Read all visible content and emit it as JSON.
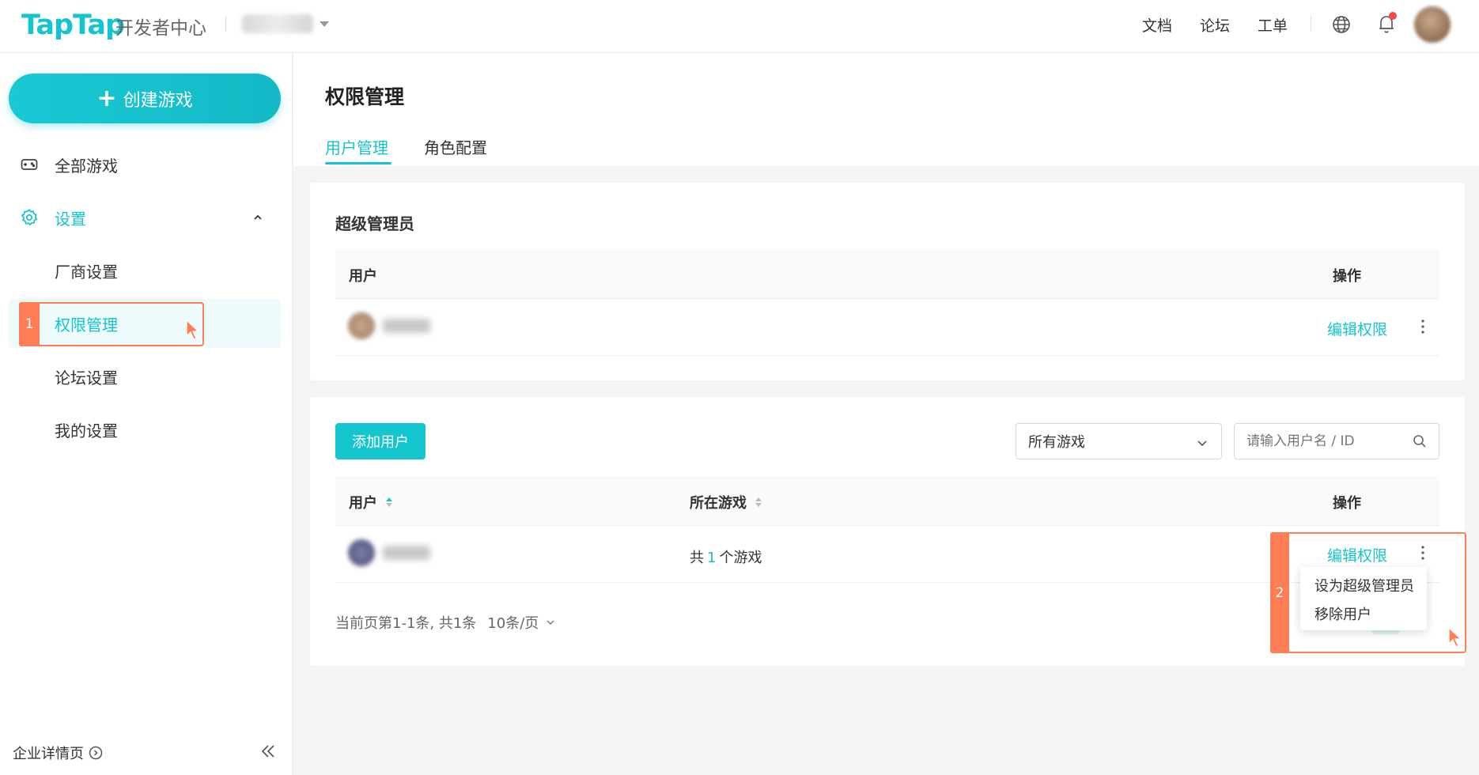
{
  "header": {
    "logo": "TapTap",
    "subtitle": "开发者中心",
    "links": [
      "文档",
      "论坛",
      "工单"
    ]
  },
  "sidebar": {
    "create_button": "创建游戏",
    "all_games": "全部游戏",
    "settings": "设置",
    "sub_items": [
      "厂商设置",
      "权限管理",
      "论坛设置",
      "我的设置"
    ],
    "company_link": "企业详情页",
    "highlight_number": "1"
  },
  "page": {
    "title": "权限管理",
    "tabs": [
      "用户管理",
      "角色配置"
    ]
  },
  "super_admin": {
    "title": "超级管理员",
    "columns": {
      "user": "用户",
      "action": "操作"
    },
    "row_action": "编辑权限"
  },
  "users": {
    "add_button": "添加用户",
    "game_filter": "所有游戏",
    "search_placeholder": "请输入用户名 / ID",
    "columns": {
      "user": "用户",
      "games": "所在游戏",
      "action": "操作"
    },
    "row": {
      "games_prefix": "共",
      "games_count": "1",
      "games_suffix": "个游戏",
      "action": "编辑权限"
    },
    "pagination": {
      "summary": "当前页第1-1条, 共1条",
      "page_size": "10条/页"
    },
    "menu": [
      "设为超级管理员",
      "移除用户"
    ],
    "highlight_number": "2"
  },
  "colors": {
    "accent": "#15c5ce",
    "highlight": "#ff7e55"
  }
}
